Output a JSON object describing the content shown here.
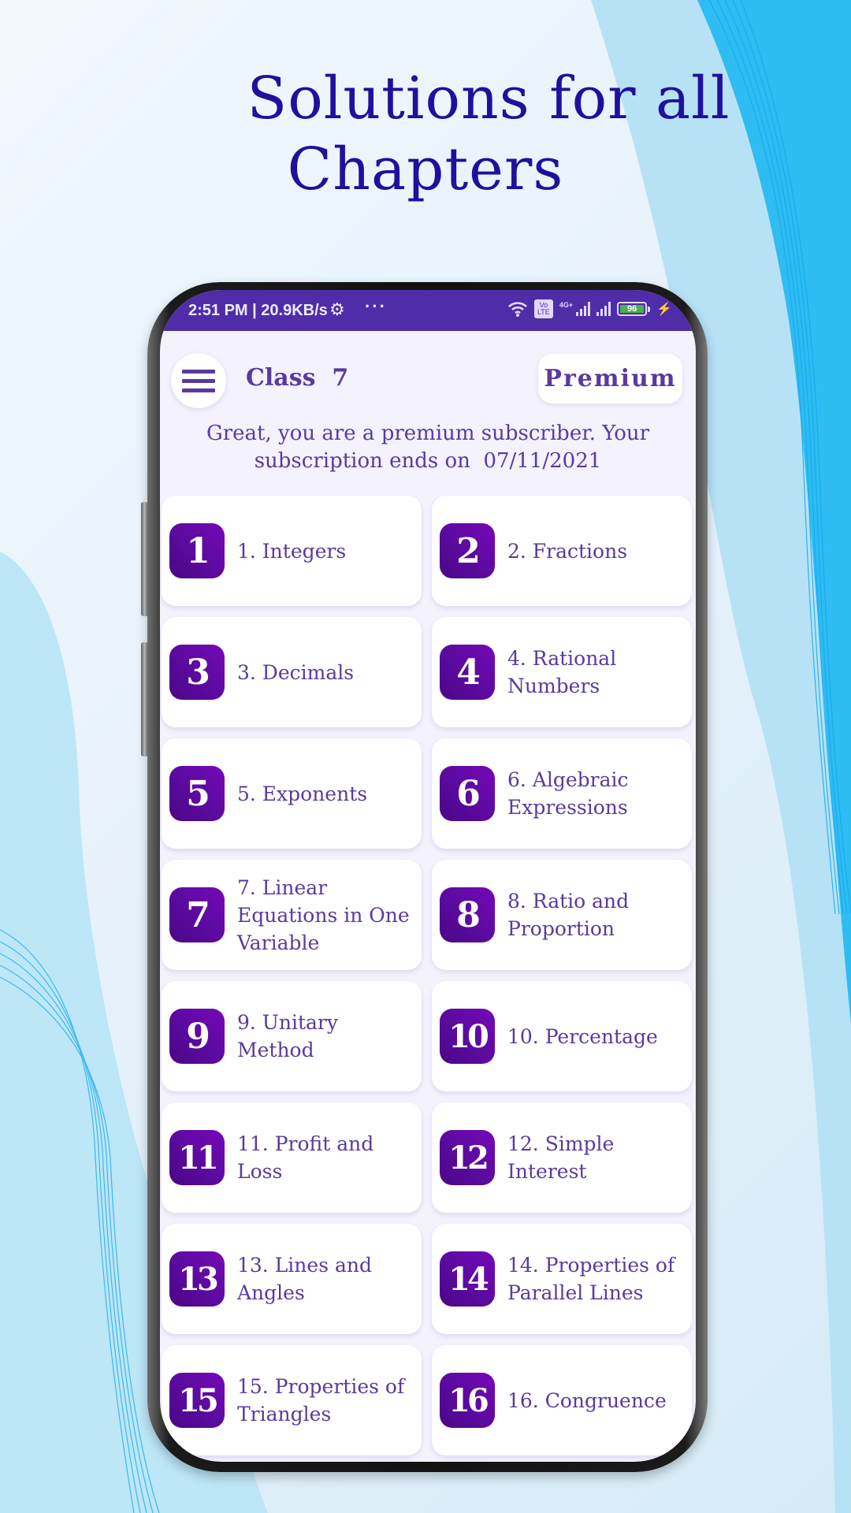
{
  "headline": {
    "line1": "Solutions for all",
    "line2": "Chapters"
  },
  "colors": {
    "headline": "#20109e",
    "statusbar": "#4f2da8",
    "accent_text": "#5a3a9e",
    "badge": "#5a0a9e",
    "battery": "#4caf50"
  },
  "statusbar": {
    "time_speed": "2:51 PM | 20.9KB/s",
    "settings_icon": "gear-icon",
    "more_icon": "···",
    "wifi_icon": "wifi-icon",
    "volte_label_top": "Vo",
    "volte_label_bottom": "LTE",
    "network_label": "4G+",
    "battery_level": "96",
    "charging_icon": "⚡"
  },
  "header": {
    "menu_icon": "hamburger-menu-icon",
    "class_title": "Class  7",
    "premium_label": "Premium"
  },
  "subscription": {
    "line1": "Great, you are a premium subscriber. Your",
    "line2": "subscription ends on  07/11/2021"
  },
  "chapters": [
    {
      "number": "1",
      "label": "1. Integers"
    },
    {
      "number": "2",
      "label": "2. Fractions"
    },
    {
      "number": "3",
      "label": "3. Decimals"
    },
    {
      "number": "4",
      "label": "4. Rational Numbers"
    },
    {
      "number": "5",
      "label": "5. Exponents"
    },
    {
      "number": "6",
      "label": "6. Algebraic Expressions"
    },
    {
      "number": "7",
      "label": "7. Linear Equations in One Variable"
    },
    {
      "number": "8",
      "label": "8. Ratio and Proportion"
    },
    {
      "number": "9",
      "label": "9. Unitary Method"
    },
    {
      "number": "10",
      "label": "10. Percentage"
    },
    {
      "number": "11",
      "label": "11. Profit and Loss"
    },
    {
      "number": "12",
      "label": "12. Simple Interest"
    },
    {
      "number": "13",
      "label": "13. Lines and Angles"
    },
    {
      "number": "14",
      "label": "14. Properties of Parallel Lines"
    },
    {
      "number": "15",
      "label": "15. Properties of Triangles"
    },
    {
      "number": "16",
      "label": "16. Congruence"
    }
  ]
}
